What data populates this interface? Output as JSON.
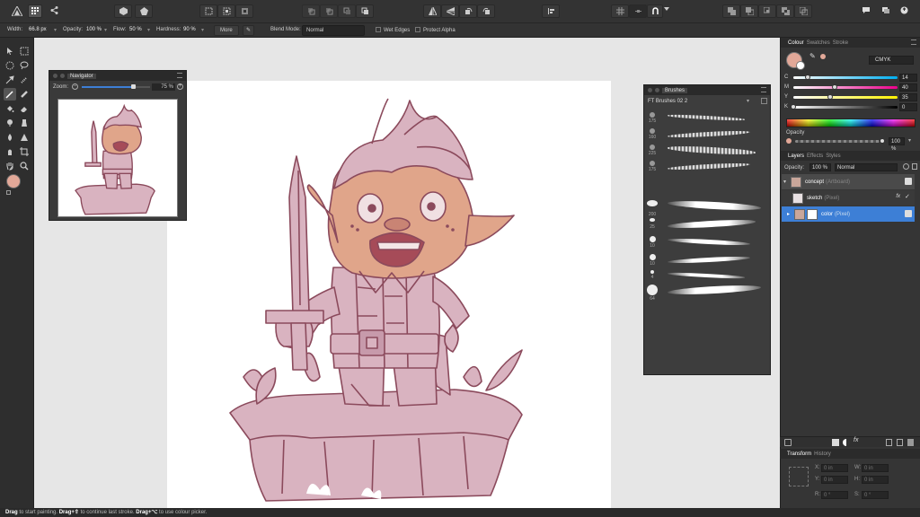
{
  "context_bar": {
    "width_label": "Width:",
    "width_value": "66.8 px",
    "opacity_label": "Opacity:",
    "opacity_value": "100 %",
    "flow_label": "Flow:",
    "flow_value": "50 %",
    "hardness_label": "Hardness:",
    "hardness_value": "90 %",
    "more_label": "More",
    "blend_label": "Blend Mode:",
    "blend_value": "Normal",
    "wet_edges": "Wet Edges",
    "protect_alpha": "Protect Alpha"
  },
  "navigator": {
    "title": "Navigator",
    "zoom_label": "Zoom:",
    "zoom_value": "75 %",
    "zoom_level": 0.75
  },
  "brushes": {
    "title": "Brushes",
    "category": "FT Brushes 02 2",
    "sizes": [
      "175",
      "160",
      "225",
      "175",
      "200",
      "25",
      "10",
      "10",
      "4",
      "64"
    ]
  },
  "colour_panel": {
    "tabs": [
      "Colour",
      "Swatches",
      "Stroke"
    ],
    "model": "CMYK",
    "channels": [
      {
        "name": "C",
        "value": "14",
        "level": 0.14
      },
      {
        "name": "M",
        "value": "40",
        "level": 0.4
      },
      {
        "name": "Y",
        "value": "35",
        "level": 0.35
      },
      {
        "name": "K",
        "value": "0",
        "level": 0.0
      }
    ],
    "opacity_label": "Opacity",
    "opacity_value": "100 %",
    "primary_color": "#e2a898"
  },
  "layers_panel": {
    "tabs": [
      "Layers",
      "Effects",
      "Styles"
    ],
    "opacity_label": "Opacity:",
    "opacity_value": "100 %",
    "blend_value": "Normal",
    "layers": [
      {
        "name": "concept",
        "kind": "(Artboard)"
      },
      {
        "name": "sketch",
        "kind": "(Pixel)"
      },
      {
        "name": "color",
        "kind": "(Pixel)"
      }
    ]
  },
  "transform_panel": {
    "tabs": [
      "Transform",
      "History"
    ],
    "x_label": "X:",
    "x_value": "0 in",
    "y_label": "Y:",
    "y_value": "0 in",
    "w_label": "W:",
    "w_value": "0 in",
    "h_label": "H:",
    "h_value": "0 in",
    "r_label": "R:",
    "r_value": "0 °",
    "s_label": "S:",
    "s_value": "0 °"
  },
  "status": {
    "part1_bold": "Drag",
    "part1": " to start painting. ",
    "part2_bold": "Drag+⇧",
    "part2": " to continue last stroke. ",
    "part3_bold": "Drag+⌥",
    "part3": " to use colour picker."
  },
  "colors": {
    "accent": "#3d7fd6",
    "sketch_line": "#8b4a5c",
    "sketch_fill": "#d9b3c0",
    "skin": "#e0a58a"
  }
}
